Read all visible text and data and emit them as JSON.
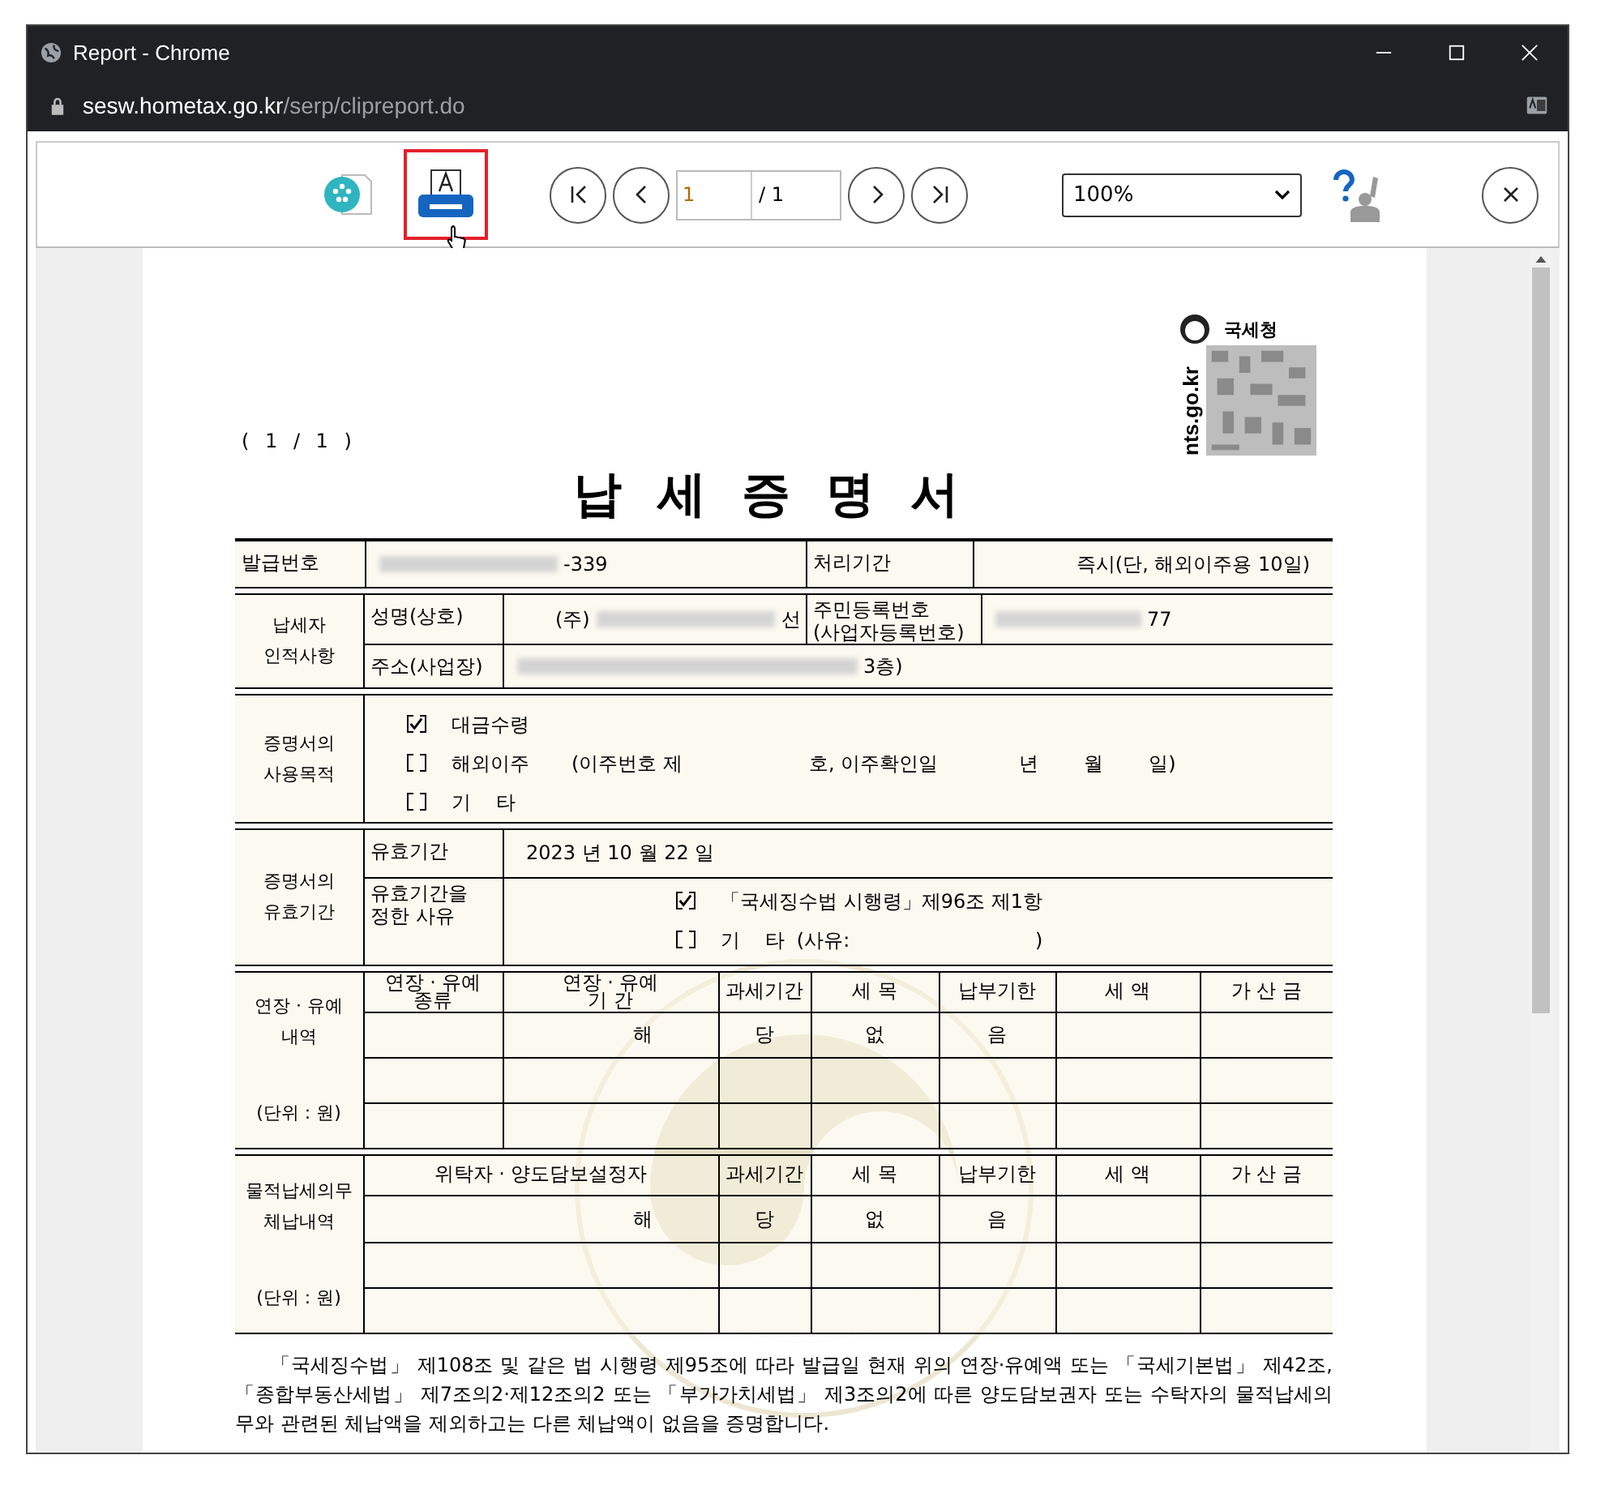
{
  "window": {
    "title": "Report - Chrome"
  },
  "address": {
    "host": "sesw.hometax.go.kr",
    "path": "/serp/clipreport.do"
  },
  "toolbar": {
    "print": {
      "highlighted": true
    },
    "page_input": "1",
    "page_total": "/ 1",
    "zoom": "100%"
  },
  "document": {
    "page_count": "( 1 / 1 )",
    "agency": "국세청",
    "site": "nts.go.kr",
    "title": "납세증명서",
    "issue": {
      "label": "발급번호",
      "value": "-339",
      "period_label": "처리기간",
      "period_value": "즉시(단, 해외이주용 10일)"
    },
    "taxpayer": {
      "label": "납세자\n인적사항",
      "name_label": "성명(상호)",
      "name_prefix": "(주)",
      "name_suffix": "선",
      "id_label": "주민등록번호\n(사업자등록번호)",
      "id_value": "77",
      "address_label": "주소(사업장)",
      "address_value": "3층)"
    },
    "purpose": {
      "label": "증명서의\n사용목적",
      "options": [
        {
          "checked": true,
          "label": "대금수령"
        },
        {
          "checked": false,
          "label": "해외이주",
          "detail": [
            "(이주번호 제",
            "호, 이주확인일",
            "년",
            "월",
            "일)"
          ]
        },
        {
          "checked": false,
          "label": "기    타"
        }
      ]
    },
    "validity": {
      "label": "증명서의\n유효기간",
      "period_label": "유효기간",
      "period_value": "2023 년  10 월  22 일",
      "reason_label": "유효기간을\n정한 사유",
      "reasons": [
        {
          "checked": true,
          "text": "「국세징수법 시행령」제96조 제1항"
        },
        {
          "checked": false,
          "text": "기    타  (사유:                              )"
        }
      ]
    },
    "deferral": {
      "label": "연장 · 유예\n내역",
      "unit": "(단위 : 원)",
      "columns": [
        "연장 · 유예\n종류",
        "연장 · 유예\n기 간",
        "과세기간",
        "세 목",
        "납부기한",
        "세 액",
        "가 산 금"
      ],
      "note": [
        "해",
        "당",
        "없",
        "음"
      ]
    },
    "secondary": {
      "label": "물적납세의무\n체납내역",
      "unit": "(단위 : 원)",
      "columns": [
        "위탁자 · 양도담보설정자",
        "과세기간",
        "세 목",
        "납부기한",
        "세 액",
        "가 산 금"
      ],
      "note": [
        "해",
        "당",
        "없",
        "음"
      ]
    },
    "statement": "「국세징수법」 제108조 및 같은 법 시행령 제95조에 따라 발급일 현재 위의 연장·유예액 또는 「국세기본법」 제42조, 「종합부동산세법」 제7조의2·제12조의2 또는 「부가가치세법」 제3조의2에 따른 양도담보권자 또는 수탁자의 물적납세의무와 관련된 체납액을 제외하고는 다른 체납액이 없음을 증명합니다."
  }
}
